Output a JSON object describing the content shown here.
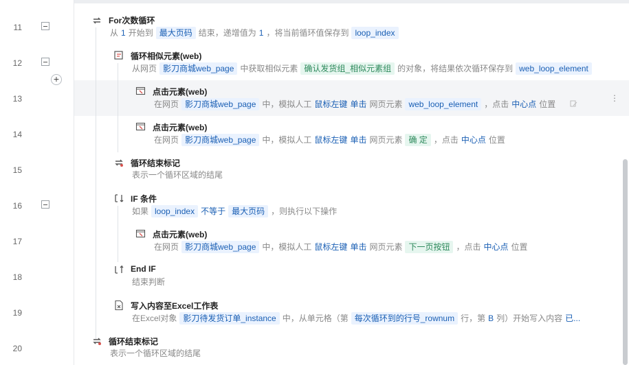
{
  "lines": [
    {
      "num": "11",
      "title": "For次数循环",
      "icon": "loop-icon",
      "desc": [
        [
          "t",
          "从"
        ],
        [
          "k",
          "1"
        ],
        [
          "t",
          "开始到"
        ],
        [
          "tag",
          "最大页码"
        ],
        [
          "t",
          "结束，递增值为"
        ],
        [
          "k",
          "1"
        ],
        [
          "t",
          "，将当前循环值保存到"
        ],
        [
          "tag",
          "loop_index"
        ]
      ]
    },
    {
      "num": "12",
      "title": "循环相似元素(web)",
      "icon": "loop-element-icon",
      "desc": [
        [
          "t",
          "从网页"
        ],
        [
          "tag",
          "影刀商城web_page"
        ],
        [
          "t",
          "中获取相似元素"
        ],
        [
          "tagg",
          "确认发货组_相似元素组"
        ],
        [
          "t",
          "的对象，将结果依次循环保存到"
        ],
        [
          "tag",
          "web_loop_element"
        ]
      ]
    },
    {
      "num": "13",
      "title": "点击元素(web)",
      "icon": "click-element-icon",
      "desc": [
        [
          "t",
          "在网页"
        ],
        [
          "tag",
          "影刀商城web_page"
        ],
        [
          "t",
          "中，模拟人工"
        ],
        [
          "k",
          "鼠标左键"
        ],
        [
          "k",
          "单击"
        ],
        [
          "t",
          "网页元素"
        ],
        [
          "tag",
          "web_loop_element"
        ],
        [
          "t",
          "，点击"
        ],
        [
          "k",
          "中心点"
        ],
        [
          "t",
          "位置"
        ]
      ]
    },
    {
      "num": "14",
      "title": "点击元素(web)",
      "icon": "click-element-icon",
      "desc": [
        [
          "t",
          "在网页"
        ],
        [
          "tag",
          "影刀商城web_page"
        ],
        [
          "t",
          "中，模拟人工"
        ],
        [
          "k",
          "鼠标左键"
        ],
        [
          "k",
          "单击"
        ],
        [
          "t",
          "网页元素"
        ],
        [
          "tagg",
          "确 定"
        ],
        [
          "t",
          "，点击"
        ],
        [
          "k",
          "中心点"
        ],
        [
          "t",
          "位置"
        ]
      ]
    },
    {
      "num": "15",
      "title": "循环结束标记",
      "icon": "loop-end-icon",
      "desc": [
        [
          "t",
          "表示一个循环区域的结尾"
        ]
      ]
    },
    {
      "num": "16",
      "title": "IF 条件",
      "icon": "if-icon",
      "desc": [
        [
          "t",
          "如果"
        ],
        [
          "tag",
          "loop_index"
        ],
        [
          "k",
          "不等于"
        ],
        [
          "tag",
          "最大页码"
        ],
        [
          "t",
          "，则执行以下操作"
        ]
      ]
    },
    {
      "num": "17",
      "title": "点击元素(web)",
      "icon": "click-element-icon",
      "desc": [
        [
          "t",
          "在网页"
        ],
        [
          "tag",
          "影刀商城web_page"
        ],
        [
          "t",
          "中，模拟人工"
        ],
        [
          "k",
          "鼠标左键"
        ],
        [
          "k",
          "单击"
        ],
        [
          "t",
          "网页元素"
        ],
        [
          "tagg",
          "下一页按钮"
        ],
        [
          "t",
          "，点击"
        ],
        [
          "k",
          "中心点"
        ],
        [
          "t",
          "位置"
        ]
      ]
    },
    {
      "num": "18",
      "title": "End IF",
      "icon": "end-if-icon",
      "desc": [
        [
          "t",
          "结束判断"
        ]
      ]
    },
    {
      "num": "19",
      "title": "写入内容至Excel工作表",
      "icon": "excel-write-icon",
      "desc": [
        [
          "t",
          "在Excel对象"
        ],
        [
          "tag",
          "影刀待发货订单_instance"
        ],
        [
          "t",
          "中，从单元格（第"
        ],
        [
          "tag",
          "每次循环到的行号_rownum"
        ],
        [
          "t",
          "行，第"
        ],
        [
          "k",
          "B"
        ],
        [
          "t",
          "列）开始写入内容"
        ],
        [
          "k",
          "已..."
        ]
      ]
    },
    {
      "num": "20",
      "title": "循环结束标记",
      "icon": "loop-end-icon",
      "desc": [
        [
          "t",
          "表示一个循环区域的结尾"
        ]
      ]
    }
  ],
  "menu_glyph": "⋮",
  "add_glyph": "+"
}
